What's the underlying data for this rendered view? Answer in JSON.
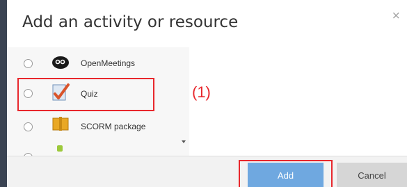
{
  "dialog": {
    "title": "Add an activity or resource",
    "close_glyph": "×"
  },
  "options": [
    {
      "label": "OpenMeetings",
      "icon": "openmeetings-icon"
    },
    {
      "label": "Quiz",
      "icon": "quiz-icon"
    },
    {
      "label": "SCORM package",
      "icon": "scorm-package-icon"
    },
    {
      "label": "",
      "icon": "partial-activity-icon"
    }
  ],
  "annotations": {
    "quiz_callout": "(1)"
  },
  "footer": {
    "add_label": "Add",
    "cancel_label": "Cancel"
  },
  "colors": {
    "highlight": "#e8272c",
    "add_button": "#6fa8e0",
    "cancel_button": "#d6d6d6"
  }
}
